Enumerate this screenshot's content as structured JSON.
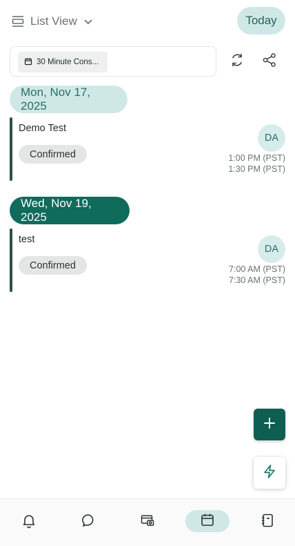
{
  "header": {
    "view_label": "List View",
    "view_icon": "list-view-icon",
    "today_label": "Today"
  },
  "filter": {
    "chip_label": "30 Minute Cons...",
    "chip_icon": "calendar-icon"
  },
  "actions": {
    "refresh_icon": "refresh-icon",
    "share_icon": "share-icon"
  },
  "days": [
    {
      "date_label": "Mon, Nov 17, 2025",
      "highlighted": false,
      "events": [
        {
          "title": "Demo Test",
          "status": "Confirmed",
          "avatar": "DA",
          "start_time": "1:00 PM (PST)",
          "end_time": "1:30 PM (PST)"
        }
      ]
    },
    {
      "date_label": "Wed, Nov 19, 2025",
      "highlighted": true,
      "events": [
        {
          "title": "test",
          "status": "Confirmed",
          "avatar": "DA",
          "start_time": "7:00 AM (PST)",
          "end_time": "7:30 AM (PST)"
        }
      ]
    }
  ],
  "fab": {
    "add_icon": "plus-icon",
    "quick_icon": "lightning-icon"
  },
  "bottom_nav": {
    "items": [
      "bell-icon",
      "chat-icon",
      "payments-icon",
      "calendar-icon",
      "contacts-icon"
    ],
    "active": "calendar-icon"
  },
  "colors": {
    "accent": "#0f6b5c",
    "accent_light": "#cfe8e6",
    "event_bar": "#2d4f4b"
  }
}
